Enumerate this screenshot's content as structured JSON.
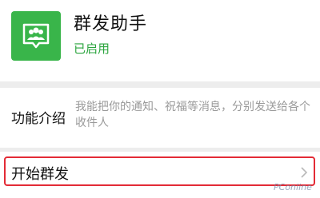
{
  "app": {
    "name": "群发助手",
    "status": "已启用",
    "icon": "group-chat-icon",
    "accent_color": "#39b54a",
    "status_color": "#2aa43d"
  },
  "intro": {
    "label": "功能介绍",
    "text": "我能把你的通知、祝福等消息，分别发送给各个收件人"
  },
  "start": {
    "label": "开始群发",
    "icon": "chevron-right-icon",
    "highlight_color": "#e32b36"
  },
  "watermark": {
    "text": "PConline"
  }
}
